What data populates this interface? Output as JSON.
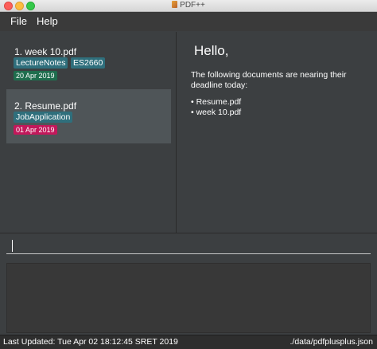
{
  "window": {
    "title": "PDF++"
  },
  "menu": {
    "file": "File",
    "help": "Help"
  },
  "documents": [
    {
      "index": "1.",
      "name": "week 10.pdf",
      "tags": [
        "LectureNotes",
        "ES2660"
      ],
      "deadline": "20 Apr 2019",
      "deadline_color": "#1f6e4e",
      "selected": false
    },
    {
      "index": "2.",
      "name": "Resume.pdf",
      "tags": [
        "JobApplication"
      ],
      "deadline": "01 Apr 2019",
      "deadline_color": "#c2185b",
      "selected": true
    }
  ],
  "details": {
    "greeting": "Hello,",
    "message": "The following documents are nearing their deadline today:",
    "due": [
      "• Resume.pdf",
      "• week 10.pdf"
    ]
  },
  "command": {
    "value": "",
    "placeholder": ""
  },
  "result": {
    "text": ""
  },
  "status": {
    "last_updated": "Last Updated: Tue Apr 02 18:12:45 SRET 2019",
    "path": "./data/pdfplusplus.json"
  },
  "colors": {
    "tag": "#2f6f7c",
    "selected": "#4f5558",
    "background": "#3c3f41"
  }
}
